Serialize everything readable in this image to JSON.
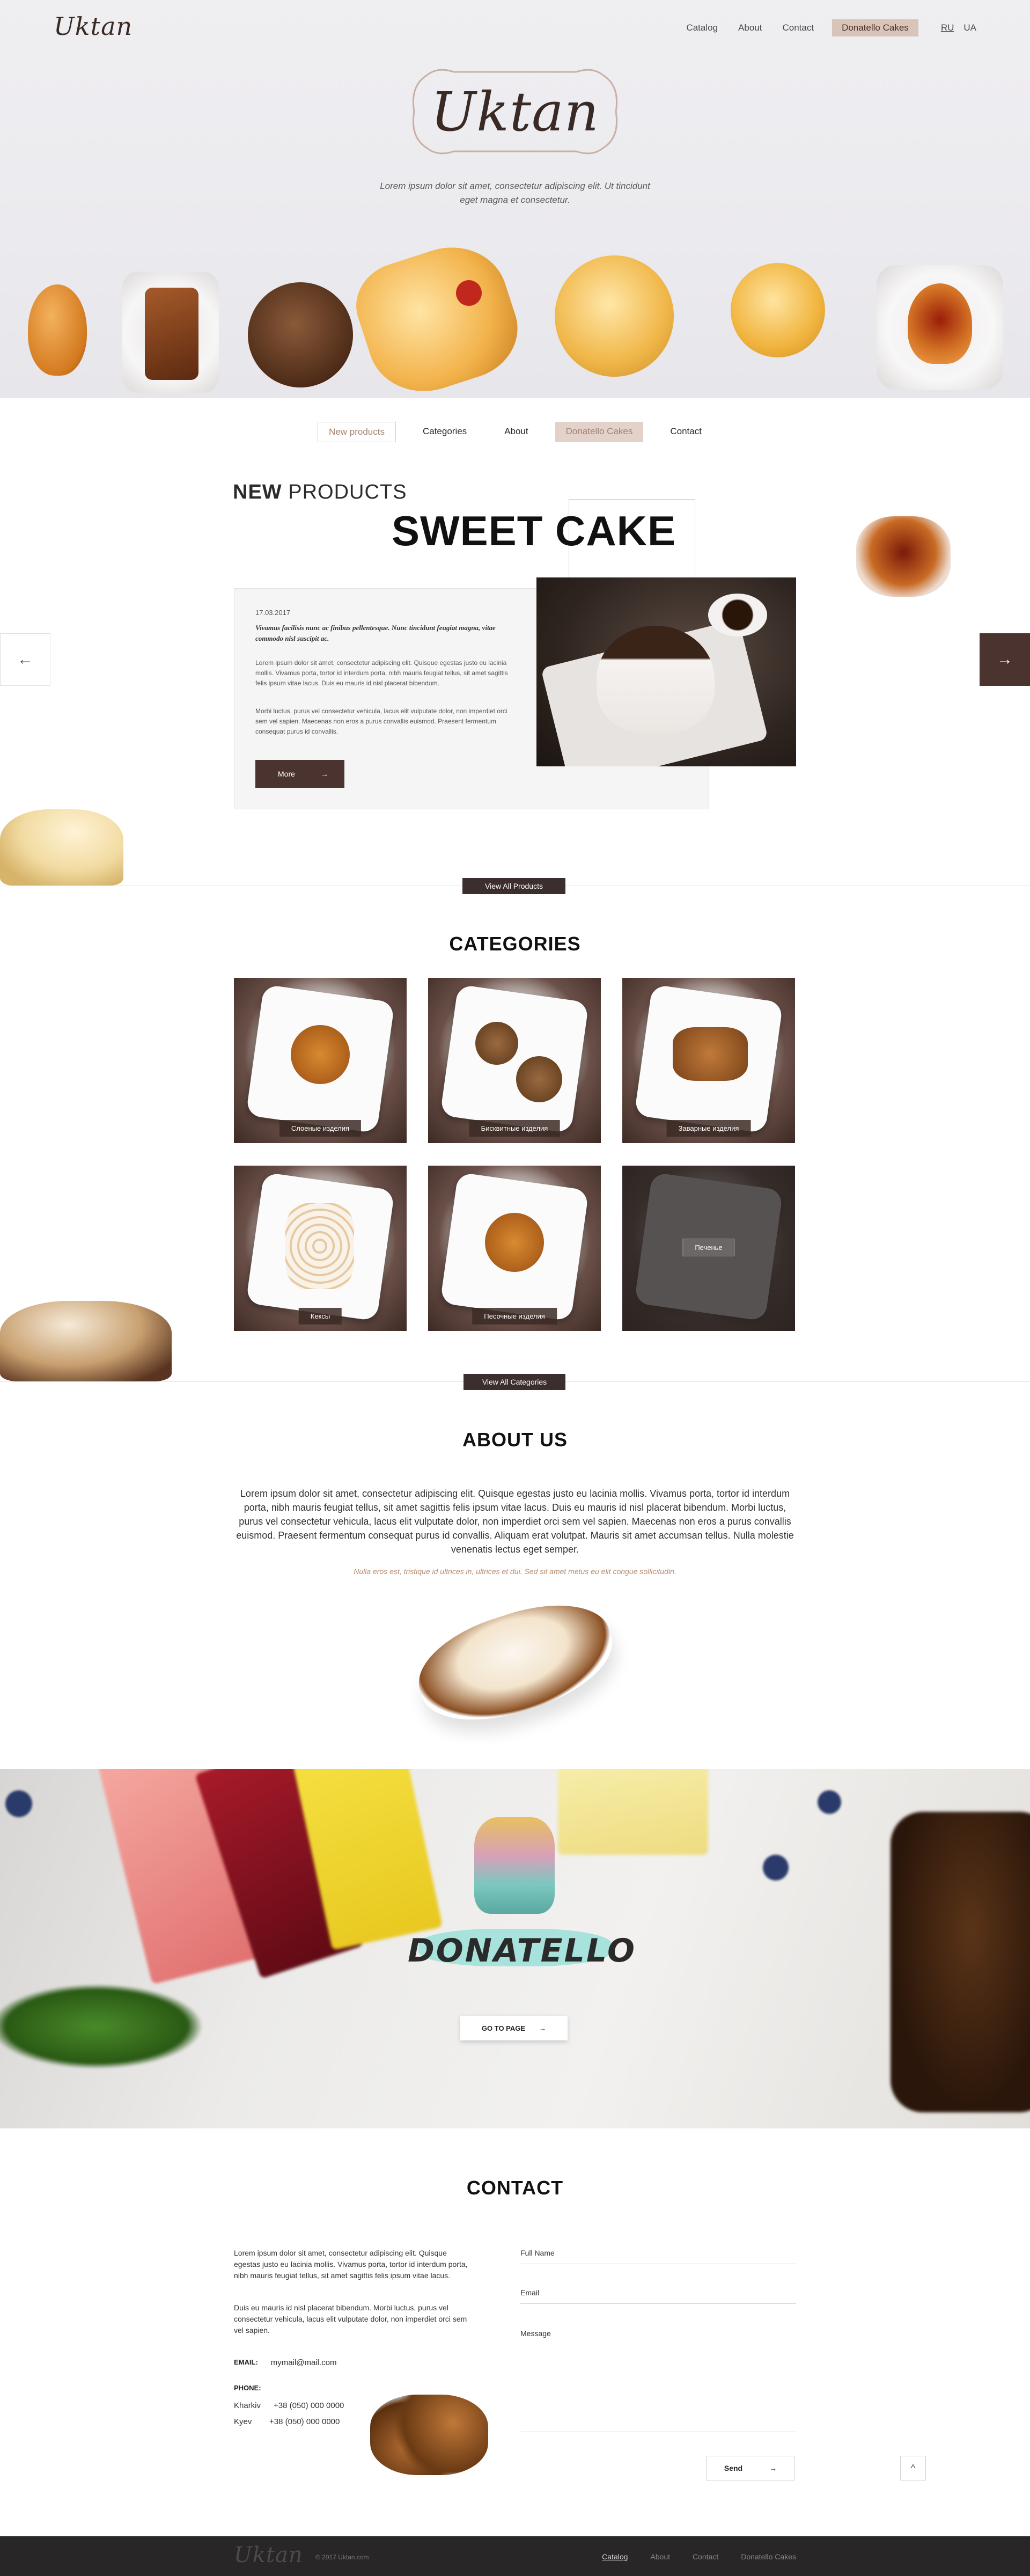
{
  "header": {
    "logo": "Uktan",
    "nav": [
      "Catalog",
      "About",
      "Contact",
      "Donatello Cakes"
    ],
    "languages": [
      "RU",
      "UA"
    ]
  },
  "hero": {
    "logo": "Uktan",
    "tagline": "Lorem ipsum dolor sit amet, consectetur adipiscing elit. Ut tincidunt eget magna et consectetur."
  },
  "subnav": [
    "New products",
    "Categories",
    "About",
    "Donatello Cakes",
    "Contact"
  ],
  "new_products": {
    "heading_bold": "NEW",
    "heading_rest": "PRODUCTS",
    "product_title": "SWEET CAKE",
    "date": "17.03.2017",
    "lead": "Vivamus facilisis nunc ac finibus pellentesque. Nunc tincidunt feugiat magna, vitae commodo nisl suscipit ac.",
    "p1": "Lorem ipsum dolor sit amet, consectetur adipiscing elit. Quisque egestas justo eu lacinia mollis. Vivamus porta, tortor id interdum porta, nibh mauris feugiat tellus, sit amet sagittis felis ipsum vitae lacus. Duis eu mauris id nisl placerat bibendum.",
    "p2": "Morbi luctus, purus vel consectetur vehicula, lacus elit vulputate dolor, non imperdiet orci sem vel sapien. Maecenas non eros a purus convallis euismod. Praesent fermentum consequat purus id convallis.",
    "more_label": "More",
    "view_all": "View All Products",
    "arrow_left": "←",
    "arrow_right": "→",
    "more_arrow": "→"
  },
  "categories": {
    "title": "CATEGORIES",
    "items": [
      "Слоеные изделия",
      "Бисквитные изделия",
      "Заварные изделия",
      "Кексы",
      "Песочные изделия",
      "Печенье"
    ],
    "view_all": "View All Categories"
  },
  "about": {
    "title": "ABOUT US",
    "text": "Lorem ipsum dolor sit amet, consectetur adipiscing elit. Quisque egestas justo eu lacinia mollis. Vivamus porta, tortor id interdum porta, nibh mauris feugiat tellus, sit amet sagittis felis ipsum vitae lacus. Duis eu mauris id nisl placerat bibendum. Morbi luctus, purus vel consectetur vehicula, lacus elit vulputate dolor, non imperdiet orci sem vel sapien. Maecenas non eros a purus convallis euismod. Praesent fermentum consequat purus id convallis. Aliquam erat volutpat. Mauris sit amet accumsan tellus. Nulla molestie venenatis lectus eget semper.",
    "quote": "Nulla eros est, tristique id ultrices in, ultrices et dui. Sed sit amet metus eu elit congue sollicitudin."
  },
  "banner": {
    "brand": "DONATELLO",
    "cta": "GO TO PAGE",
    "cta_arrow": "→"
  },
  "contact": {
    "title": "CONTACT",
    "p1": "Lorem ipsum dolor sit amet, consectetur adipiscing elit. Quisque egestas justo eu lacinia mollis. Vivamus porta, tortor id interdum porta, nibh mauris feugiat tellus, sit amet sagittis felis ipsum vitae lacus.",
    "p2": "Duis eu mauris id nisl placerat bibendum. Morbi luctus, purus vel consectetur vehicula, lacus elit vulputate dolor, non imperdiet orci sem vel sapien.",
    "email_label": "EMAIL:",
    "email": "mymail@mail.com",
    "phone_label": "PHONE:",
    "phones": [
      {
        "city": "Kharkiv",
        "number": "+38 (050) 000 0000"
      },
      {
        "city": "Kyev",
        "number": "+38 (050) 000 0000"
      }
    ],
    "form": {
      "name_label": "Full Name",
      "email_label": "Email",
      "message_label": "Message",
      "send_label": "Send",
      "send_arrow": "→"
    },
    "up_arrow": "^"
  },
  "footer": {
    "logo": "Uktan",
    "copyright": "© 2017 Uktan.com",
    "nav": [
      "Catalog",
      "About",
      "Contact",
      "Donatello Cakes"
    ]
  },
  "colors": {
    "brand_brown": "#4b3430",
    "accent_rose": "#d9c4ba",
    "footer_bg": "#282626",
    "quote_gold": "#b88c6e"
  }
}
